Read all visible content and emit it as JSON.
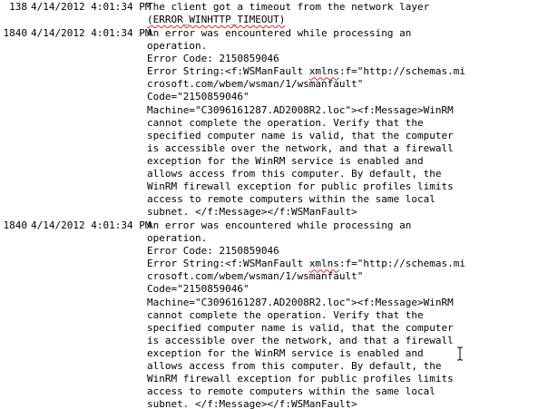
{
  "log": [
    {
      "id": "138",
      "timestamp": "4/14/2012 4:01:34 PM",
      "lines": [
        [
          {
            "t": "The client got a timeout from the network layer"
          }
        ],
        [
          {
            "t": "(ERROR_WINHTTP_TIMEOUT)",
            "squiggle": true
          }
        ]
      ]
    },
    {
      "id": "1840",
      "timestamp": "4/14/2012 4:01:34 PM",
      "lines": [
        [
          {
            "t": "An error was encountered while processing an"
          }
        ],
        [
          {
            "t": "operation."
          }
        ],
        [
          {
            "t": "Error Code: 2150859046"
          }
        ],
        [
          {
            "t": "Error String:<f:WSManFault "
          },
          {
            "t": "xmlns",
            "squiggle": true
          },
          {
            "t": ":f=\"http://schemas.mi"
          }
        ],
        [
          {
            "t": "crosoft.com/wbem/wsman/1/wsmanfault\""
          }
        ],
        [
          {
            "t": "Code=\"2150859046\""
          }
        ],
        [
          {
            "t": "Machine=\"C3096161287.AD2008R2.loc\"><f:Message>WinRM"
          }
        ],
        [
          {
            "t": "cannot complete the operation. Verify that the"
          }
        ],
        [
          {
            "t": "specified computer name is valid, that the computer"
          }
        ],
        [
          {
            "t": "is accessible over the network, and that a firewall"
          }
        ],
        [
          {
            "t": "exception for the WinRM service is enabled and"
          }
        ],
        [
          {
            "t": "allows access from this computer. By default, the"
          }
        ],
        [
          {
            "t": "WinRM firewall exception for public profiles limits"
          }
        ],
        [
          {
            "t": "access to remote computers within the same local"
          }
        ],
        [
          {
            "t": "subnet. </f:Message></f:WSManFault>"
          }
        ]
      ]
    },
    {
      "id": "1840",
      "timestamp": "4/14/2012 4:01:34 PM",
      "lines": [
        [
          {
            "t": "An error was encountered while processing an"
          }
        ],
        [
          {
            "t": "operation."
          }
        ],
        [
          {
            "t": "Error Code: 2150859046"
          }
        ],
        [
          {
            "t": "Error String:<f:WSManFault "
          },
          {
            "t": "xmlns",
            "squiggle": true
          },
          {
            "t": ":f=\"http://schemas.mi"
          }
        ],
        [
          {
            "t": "crosoft.com/wbem/wsman/1/wsmanfault\""
          }
        ],
        [
          {
            "t": "Code=\"2150859046\""
          }
        ],
        [
          {
            "t": "Machine=\"C3096161287.AD2008R2.loc\"><f:Message>WinRM"
          }
        ],
        [
          {
            "t": "cannot complete the operation. Verify that the"
          }
        ],
        [
          {
            "t": "specified computer name is valid, that the computer"
          }
        ],
        [
          {
            "t": "is accessible over the network, and that a firewall"
          }
        ],
        [
          {
            "t": "exception for the WinRM service is enabled and"
          }
        ],
        [
          {
            "t": "allows access from this computer. By default, the"
          }
        ],
        [
          {
            "t": "WinRM firewall exception for public profiles limits"
          }
        ],
        [
          {
            "t": "access to remote computers within the same local"
          }
        ],
        [
          {
            "t": "subnet. </f:Message></f:WSManFault>"
          }
        ]
      ]
    }
  ],
  "cursor": {
    "icon": "text-cursor-icon"
  },
  "colors": {
    "spellcheck_underline": "#d12a2a",
    "text": "#000000",
    "background": "#ffffff"
  }
}
